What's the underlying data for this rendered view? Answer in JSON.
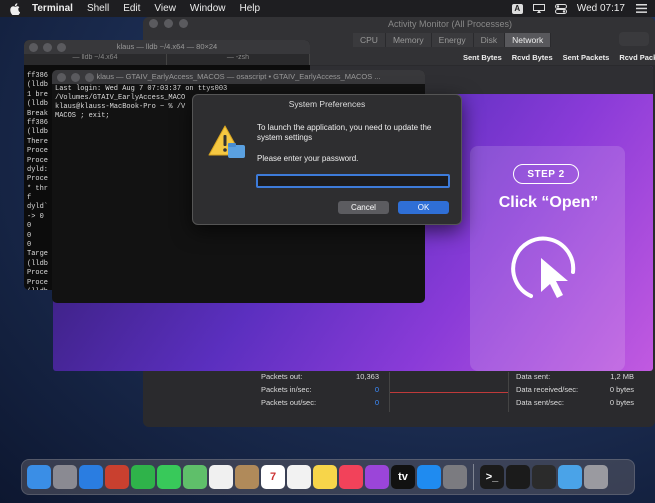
{
  "menubar": {
    "app_name": "Terminal",
    "items": [
      "Shell",
      "Edit",
      "View",
      "Window",
      "Help"
    ],
    "keyboard_badge": "A",
    "clock": "Wed 07:17"
  },
  "activity_monitor": {
    "title": "Activity Monitor (All Processes)",
    "tabs": [
      "CPU",
      "Memory",
      "Energy",
      "Disk",
      "Network"
    ],
    "active_tab": "Network",
    "columns": [
      "Sent Bytes",
      "Rcvd Bytes",
      "Sent Packets",
      "Rcvd Packets"
    ],
    "packets": [
      {
        "label": "Packets out:",
        "value": "10,363"
      },
      {
        "label": "Packets in/sec:",
        "value": "0"
      },
      {
        "label": "Packets out/sec:",
        "value": "0"
      }
    ],
    "data": [
      {
        "label": "Data sent:",
        "value": "1,2 MB"
      },
      {
        "label": "Data received/sec:",
        "value": "0 bytes"
      },
      {
        "label": "Data sent/sec:",
        "value": "0 bytes"
      }
    ]
  },
  "promo": {
    "step": "STEP 2",
    "action": "Click “Open”"
  },
  "terminal_back": {
    "title": "klaus — lldb ~/4.x64 — 80×24",
    "tabs": [
      "— lldb ~/4.x64",
      "— -zsh"
    ],
    "lines": [
      "ff386",
      "(lldb",
      " 1 bre",
      "(lldb",
      "Break",
      "ff386",
      "(lldb",
      "There",
      "Proce",
      "Proce",
      "dyld:",
      "Proce",
      "* thr",
      "    f",
      "dyld`",
      "->  0",
      "    0",
      "    0",
      "    0",
      "Targe",
      "(lldb",
      "Proce",
      "Proce",
      "(lldb"
    ]
  },
  "terminal_front": {
    "title": "klaus — GTAIV_EarlyAccess_MACOS — osascript • GTAIV_EarlyAccess_MACOS ...",
    "lines": [
      "Last login: Wed Aug  7 07:03:37 on ttys003",
      "/Volumes/GTAIV_EarlyAccess_MACO",
      "klaus@klauss-MacBook-Pro ~ % /V",
      "MACOS ; exit;"
    ]
  },
  "dialog": {
    "title": "System Preferences",
    "message": "To launch the application, you need to update the system settings",
    "prompt": "Please enter your password.",
    "password_value": "",
    "cancel_label": "Cancel",
    "ok_label": "OK"
  },
  "dock": {
    "apps": [
      {
        "name": "finder",
        "color": "#3a8ee6",
        "glyph": ""
      },
      {
        "name": "launchpad",
        "color": "#8a8a92",
        "glyph": ""
      },
      {
        "name": "safari",
        "color": "#2a7de1",
        "glyph": ""
      },
      {
        "name": "photo-booth",
        "color": "#c9402f",
        "glyph": ""
      },
      {
        "name": "facetime",
        "color": "#2fb34a",
        "glyph": ""
      },
      {
        "name": "messages",
        "color": "#38c95a",
        "glyph": ""
      },
      {
        "name": "maps",
        "color": "#5fbf6a",
        "glyph": ""
      },
      {
        "name": "photos",
        "color": "#f0f0f0",
        "glyph": ""
      },
      {
        "name": "contacts",
        "color": "#b08a5a",
        "glyph": ""
      },
      {
        "name": "calendar",
        "color": "#ffffff",
        "glyph": "7"
      },
      {
        "name": "reminders",
        "color": "#f2f2f2",
        "glyph": ""
      },
      {
        "name": "notes",
        "color": "#f7d54a",
        "glyph": ""
      },
      {
        "name": "music",
        "color": "#f2425a",
        "glyph": ""
      },
      {
        "name": "podcasts",
        "color": "#9b45d9",
        "glyph": ""
      },
      {
        "name": "apple-tv",
        "color": "#111111",
        "glyph": "tv"
      },
      {
        "name": "app-store",
        "color": "#1f8bf0",
        "glyph": ""
      },
      {
        "name": "system-preferences",
        "color": "#7b7b80",
        "glyph": ""
      },
      {
        "name": "terminal",
        "color": "#1b1b1b",
        "glyph": ">_"
      },
      {
        "name": "activity-monitor",
        "color": "#1b1b1b",
        "glyph": ""
      },
      {
        "name": "console",
        "color": "#2b2b2b",
        "glyph": ""
      },
      {
        "name": "downloads-folder",
        "color": "#4aa3e8",
        "glyph": ""
      },
      {
        "name": "trash",
        "color": "#9a9aa0",
        "glyph": ""
      }
    ]
  }
}
